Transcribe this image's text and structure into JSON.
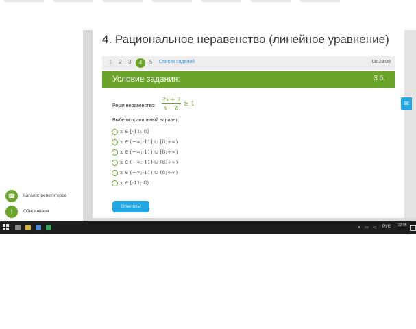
{
  "page": {
    "title": "4. Рациональное неравенство (линейное уравнение)"
  },
  "nav": {
    "tasks": [
      "1",
      "2",
      "3",
      "4",
      "5"
    ],
    "active": "4",
    "task_list_label": "Список заданий",
    "timer": "00:23:09"
  },
  "task": {
    "header": "Условие задания:",
    "points": "3 б.",
    "prompt": "Реши неравенство:",
    "numerator": "2x + 3",
    "denominator": "x − 8",
    "relation": "≥ 1",
    "choose_label": "Выбери правильный вариант:",
    "options": [
      "x ∈ [-11; 8]",
      "x ∈ (−∞;-11] ∪ [8;+∞)",
      "x ∈ (−∞;-11) ∪ [8;+∞)",
      "x ∈ (−∞;-11] ∪ (8;+∞)",
      "x ∈ (−∞;-11) ∪ (8;+∞)",
      "x ∈ [-11; 8)"
    ],
    "submit_label": "Ответить!"
  },
  "sidebar": {
    "items": [
      {
        "icon": "phone-icon",
        "glyph": "☎",
        "label": "Каталог репетиторов"
      },
      {
        "icon": "exclamation-icon",
        "glyph": "!",
        "label": "Обновления"
      }
    ]
  },
  "taskbar": {
    "language": "РУС",
    "time": "22:05"
  },
  "colors": {
    "accent_green": "#6aa42a",
    "button_blue": "#22a7e3"
  }
}
